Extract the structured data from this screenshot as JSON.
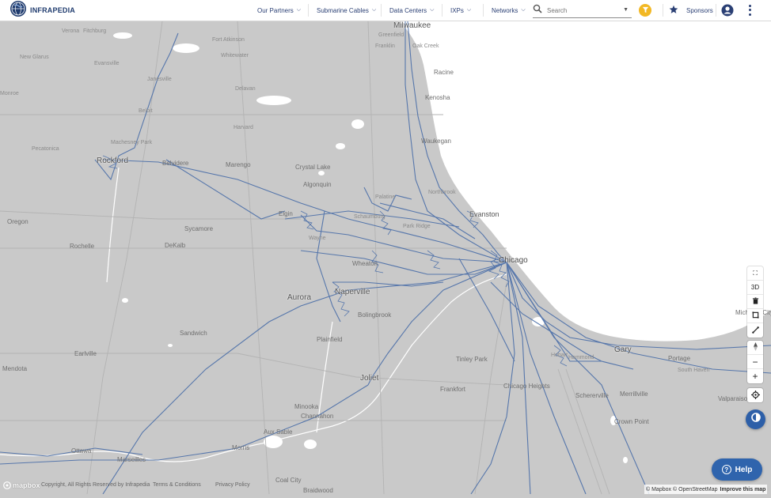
{
  "brand": {
    "name": "INFRAPEDIA"
  },
  "nav": [
    {
      "label": "Our Partners"
    },
    {
      "label": "Submarine Cables"
    },
    {
      "label": "Data Centers"
    },
    {
      "label": "IXPs"
    },
    {
      "label": "Networks"
    }
  ],
  "search": {
    "placeholder": "Search",
    "value": ""
  },
  "sponsors": {
    "label": "Sponsors"
  },
  "icons": {
    "logo": "globe-icon",
    "search": "search-icon",
    "filter": "filter-icon",
    "star": "star-icon",
    "account": "account-icon",
    "menu": "more-vert-icon"
  },
  "colors": {
    "accent": "#2f64ad",
    "filter": "#f2b824",
    "land": "#c9c9c9",
    "water": "#ffffff",
    "network": "#4a6ea8",
    "road": "#b0b0b0"
  },
  "map": {
    "labels_major": [
      {
        "text": "Milwaukee"
      },
      {
        "text": "Chicago"
      },
      {
        "text": "Aurora"
      },
      {
        "text": "Joliet"
      },
      {
        "text": "Rockford"
      },
      {
        "text": "Naperville"
      },
      {
        "text": "Gary"
      },
      {
        "text": "Evanston"
      }
    ],
    "labels_city": [
      {
        "text": "Racine"
      },
      {
        "text": "Kenosha"
      },
      {
        "text": "Waukegan"
      },
      {
        "text": "Elgin"
      },
      {
        "text": "DeKalb"
      },
      {
        "text": "Wheaton"
      },
      {
        "text": "Bolingbrook"
      },
      {
        "text": "Plainfield"
      },
      {
        "text": "Tinley Park"
      },
      {
        "text": "Frankfort"
      },
      {
        "text": "Chicago Heights"
      },
      {
        "text": "Portage"
      },
      {
        "text": "Merrillville"
      },
      {
        "text": "Schererville"
      },
      {
        "text": "Crown Point"
      },
      {
        "text": "Valparaiso"
      },
      {
        "text": "Michigan City"
      },
      {
        "text": "Mendota"
      },
      {
        "text": "Earlville"
      },
      {
        "text": "Sandwich"
      },
      {
        "text": "Ottawa"
      },
      {
        "text": "Marseilles"
      },
      {
        "text": "Morris"
      },
      {
        "text": "Coal City"
      },
      {
        "text": "Braidwood"
      },
      {
        "text": "Minooka"
      },
      {
        "text": "Channahon"
      },
      {
        "text": "Sycamore"
      },
      {
        "text": "Rochelle"
      },
      {
        "text": "Oregon"
      },
      {
        "text": "Belvidere"
      },
      {
        "text": "Marengo"
      },
      {
        "text": "Crystal Lake"
      },
      {
        "text": "Algonquin"
      },
      {
        "text": "Harvard"
      },
      {
        "text": "Beloit"
      },
      {
        "text": "Janesville"
      },
      {
        "text": "Whitewater"
      },
      {
        "text": "Delavan"
      },
      {
        "text": "Greenfield"
      },
      {
        "text": "Franklin"
      },
      {
        "text": "Oak Creek"
      },
      {
        "text": "Northbrook"
      },
      {
        "text": "Palatine"
      },
      {
        "text": "Schaumburg"
      },
      {
        "text": "Wayne"
      },
      {
        "text": "Hobart"
      },
      {
        "text": "South Haven"
      },
      {
        "text": "Machesney Park"
      },
      {
        "text": "Evansville"
      },
      {
        "text": "New Glarus"
      },
      {
        "text": "Fort Atkinson"
      },
      {
        "text": "Verona"
      },
      {
        "text": "Fitchburg"
      },
      {
        "text": "Monroe"
      },
      {
        "text": "Pecatonica"
      },
      {
        "text": "Aux Sable"
      },
      {
        "text": "Park Ridge"
      },
      {
        "text": "Hammond"
      }
    ]
  },
  "controls": {
    "three_d": "3D"
  },
  "help": {
    "label": "Help"
  },
  "footer": {
    "copyright": "Copyright, All Rights Reserved by Infrapedia",
    "terms": "Terms & Conditions",
    "privacy": "Privacy Policy"
  },
  "attribution": {
    "mapbox": "© Mapbox",
    "osm": "© OpenStreetMap",
    "improve": "Improve this map"
  }
}
